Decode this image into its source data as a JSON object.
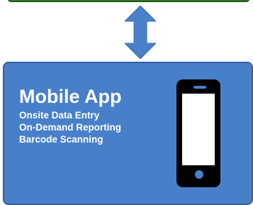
{
  "mobile_app": {
    "title": "Mobile App",
    "features": [
      "Onsite Data Entry",
      "On-Demand Reporting",
      "Barcode Scanning"
    ]
  },
  "icons": {
    "connector": "double-headed-vertical-arrow-icon",
    "device": "smartphone-icon"
  },
  "colors": {
    "top_box_fill": "#3a7d32",
    "app_box_fill": "#4780c9",
    "arrow_fill": "#4a80c8",
    "text": "#ffffff"
  }
}
